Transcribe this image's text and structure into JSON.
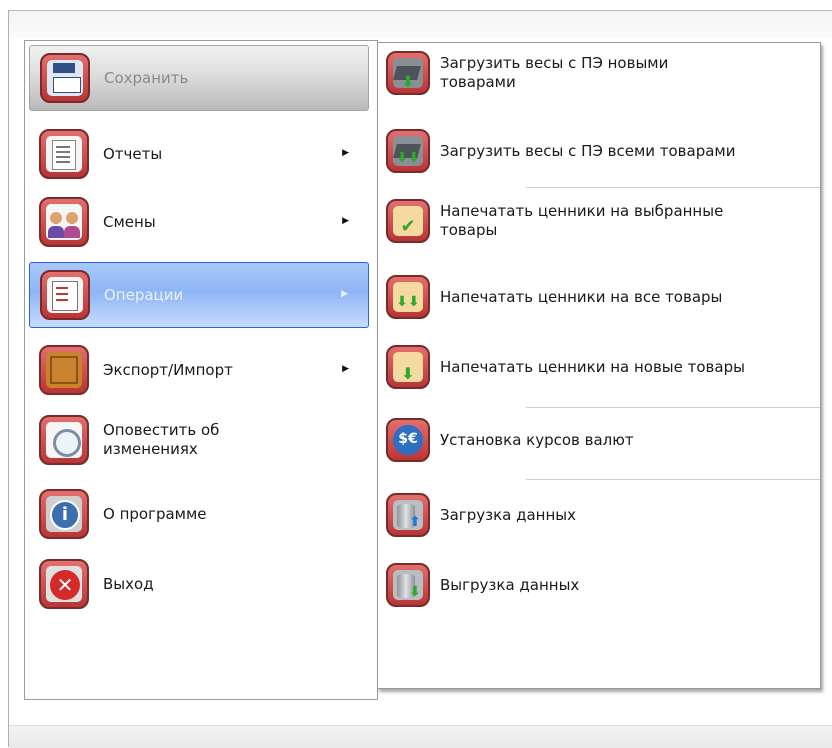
{
  "left_menu": {
    "items": [
      {
        "label": "Сохранить",
        "icon": "floppy-disk-icon",
        "submenu": false,
        "state": "pressed"
      },
      {
        "label": "Отчеты",
        "icon": "documents-icon",
        "submenu": true
      },
      {
        "label": "Смены",
        "icon": "users-shift-icon",
        "submenu": true
      },
      {
        "label": "Операции",
        "icon": "clipboard-edit-icon",
        "submenu": true,
        "state": "highlighted"
      },
      {
        "label": "Экспорт/Импорт",
        "icon": "box-icon",
        "submenu": true
      },
      {
        "label": "Оповестить об\nизменениях",
        "icon": "alarm-clock-icon",
        "submenu": false
      },
      {
        "label": "О программе",
        "icon": "info-icon",
        "submenu": false
      },
      {
        "label": "Выход",
        "icon": "exit-icon",
        "submenu": false
      }
    ]
  },
  "right_menu": {
    "items": [
      {
        "label": "Загрузить весы с ПЭ новыми\nтоварами",
        "icon": "scale-upload-new-icon"
      },
      {
        "label": "Загрузить весы с ПЭ всеми товарами",
        "icon": "scale-upload-all-icon"
      },
      {
        "label": "Напечатать ценники на выбранные\nтовары",
        "icon": "price-tag-selected-icon"
      },
      {
        "label": "Напечатать ценники на все товары",
        "icon": "price-tag-all-icon"
      },
      {
        "label": "Напечатать ценники на новые товары",
        "icon": "price-tag-new-icon"
      },
      {
        "label": "Установка курсов валют",
        "icon": "currency-icon"
      },
      {
        "label": "Загрузка данных",
        "icon": "database-upload-icon"
      },
      {
        "label": "Выгрузка данных",
        "icon": "database-download-icon"
      }
    ]
  },
  "colors": {
    "highlight_border": "#2f62d8",
    "highlight_fill": "#9dbdf7",
    "icon_frame": "#b93535"
  }
}
